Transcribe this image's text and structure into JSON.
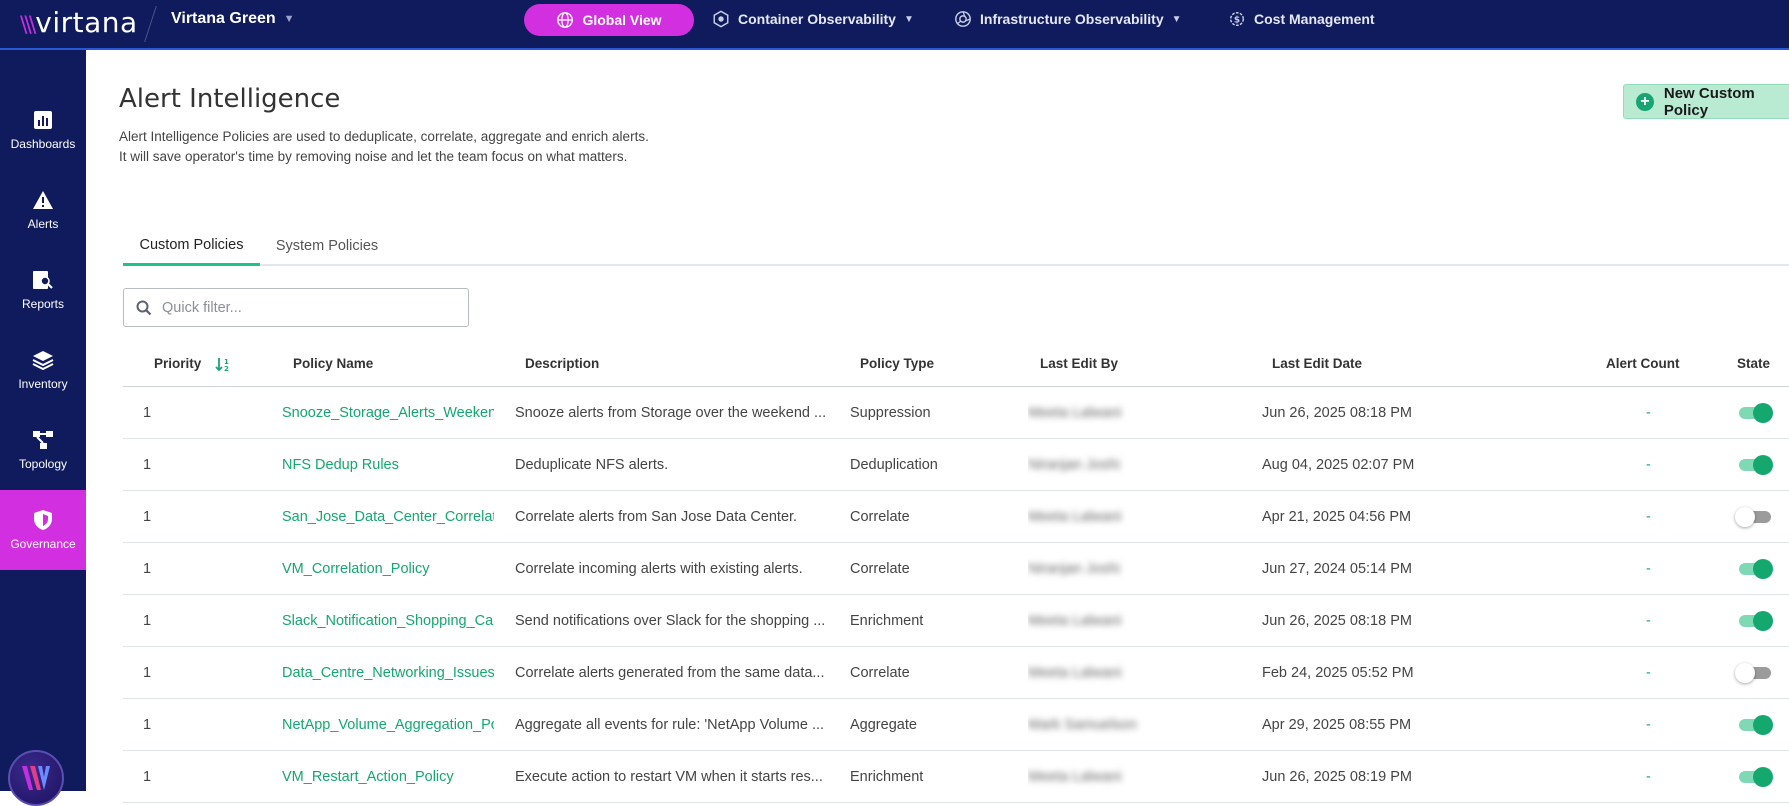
{
  "topbar": {
    "logo": "virtana",
    "tenant": "Virtana Green",
    "global_view": "Global View",
    "nav": [
      {
        "label": "Container Observability",
        "has_menu": true
      },
      {
        "label": "Infrastructure Observability",
        "has_menu": true
      },
      {
        "label": "Cost Management",
        "has_menu": false
      }
    ]
  },
  "sidebar": {
    "items": [
      {
        "label": "Dashboards",
        "icon": "bar-chart-icon"
      },
      {
        "label": "Alerts",
        "icon": "warning-icon"
      },
      {
        "label": "Reports",
        "icon": "report-search-icon"
      },
      {
        "label": "Inventory",
        "icon": "layers-icon"
      },
      {
        "label": "Topology",
        "icon": "topology-icon"
      },
      {
        "label": "Governance",
        "icon": "shield-icon",
        "active": true
      }
    ]
  },
  "page": {
    "title": "Alert Intelligence",
    "description_line1": "Alert Intelligence Policies are used to deduplicate, correlate, aggregate and enrich alerts.",
    "description_line2": "It will save operator's time by removing noise and let the team focus on what matters.",
    "new_button": "New Custom Policy"
  },
  "tabs": [
    {
      "label": "Custom Policies",
      "active": true
    },
    {
      "label": "System Policies",
      "active": false
    }
  ],
  "filter": {
    "placeholder": "Quick filter..."
  },
  "table": {
    "columns": [
      "Priority",
      "Policy Name",
      "Description",
      "Policy Type",
      "Last Edit By",
      "Last Edit Date",
      "Alert Count",
      "State"
    ],
    "rows": [
      {
        "priority": "1",
        "name": "Snooze_Storage_Alerts_Weekend",
        "description": "Snooze alerts from Storage over the weekend ...",
        "type": "Suppression",
        "editor": "Meeta Lalwani",
        "date": "Jun 26, 2025 08:18 PM",
        "count": "-",
        "state": "on"
      },
      {
        "priority": "1",
        "name": "NFS Dedup Rules",
        "description": "Deduplicate NFS alerts.",
        "type": "Deduplication",
        "editor": "Niranjan Joshi",
        "date": "Aug 04, 2025 02:07 PM",
        "count": "-",
        "state": "on"
      },
      {
        "priority": "1",
        "name": "San_Jose_Data_Center_Correlation",
        "description": "Correlate alerts from San Jose Data Center.",
        "type": "Correlate",
        "editor": "Meeta Lalwani",
        "date": "Apr 21, 2025 04:56 PM",
        "count": "-",
        "state": "off"
      },
      {
        "priority": "1",
        "name": "VM_Correlation_Policy",
        "description": "Correlate incoming alerts with existing alerts.",
        "type": "Correlate",
        "editor": "Niranjan Joshi",
        "date": "Jun 27, 2024 05:14 PM",
        "count": "-",
        "state": "on"
      },
      {
        "priority": "1",
        "name": "Slack_Notification_Shopping_Cart",
        "description": "Send notifications over Slack for the shopping ...",
        "type": "Enrichment",
        "editor": "Meeta Lalwani",
        "date": "Jun 26, 2025 08:18 PM",
        "count": "-",
        "state": "on"
      },
      {
        "priority": "1",
        "name": "Data_Centre_Networking_Issues_",
        "description": "Correlate alerts generated from the same data...",
        "type": "Correlate",
        "editor": "Meeta Lalwani",
        "date": "Feb 24, 2025 05:52 PM",
        "count": "-",
        "state": "off"
      },
      {
        "priority": "1",
        "name": "NetApp_Volume_Aggregation_Policy",
        "description": "Aggregate all events for rule: 'NetApp Volume ...",
        "type": "Aggregate",
        "editor": "Mark Samuelson",
        "date": "Apr 29, 2025 08:55 PM",
        "count": "-",
        "state": "on"
      },
      {
        "priority": "1",
        "name": "VM_Restart_Action_Policy",
        "description": "Execute action to restart VM when it starts res...",
        "type": "Enrichment",
        "editor": "Meeta Lalwani",
        "date": "Jun 26, 2025 08:19 PM",
        "count": "-",
        "state": "on"
      }
    ]
  },
  "colors": {
    "navy": "#0f1b5c",
    "magenta": "#d12fe0",
    "green": "#14a86e"
  }
}
